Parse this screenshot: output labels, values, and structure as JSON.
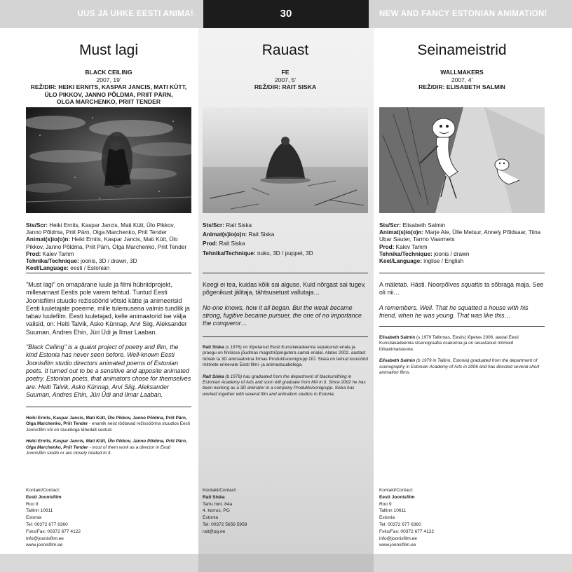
{
  "header": {
    "left_text": "UUS JA UHKE EESTI ANIMA!",
    "page_number": "30",
    "right_text": "NEW AND FANCY ESTONIAN ANIMATION!"
  },
  "films": [
    {
      "title": "Must lagi",
      "en_title": "BLACK CEILING",
      "year": "2007, 19'",
      "director_lines": [
        "REŽ/DIR: HEIKI ERNITS, KASPAR JANCIS, MATI KÜTT,",
        "ÜLO PIKKOV, JANNO PÕLDMA, PRIIT PÄRN,",
        "OLGA MARCHENKO, PRIIT TENDER"
      ],
      "credits": [
        {
          "label": "Sts/Scr:",
          "text": "Heiki Ernits, Kaspar Jancis, Mati Kütt, Ülo Pikkov, Janno Põldma, Priit Pärn, Olga Marchenko, Priit Tender"
        },
        {
          "label": "Animat(s)io(o)n:",
          "text": "Heiki Ernits, Kaspar Jancis, Mati Kütt, Ülo Pikkov, Janno Põldma, Priit Pärn, Olga Marchenko, Priit Tender"
        },
        {
          "label": "Prod:",
          "text": "Kalev Tamm"
        },
        {
          "label": "Tehnika/Technique:",
          "text": "joonis, 3D / drawn, 3D"
        },
        {
          "label": "Keel/Language:",
          "text": "eesti / Estonian"
        }
      ],
      "story_et": "\"Must lagi\" on omapärane luule ja filmi hübriidprojekt, millesarnast Eestis pole varem tehtud. Tuntud Eesti Joonisfilmi stuudio režissöörid võtsid kätte ja animeerisid Eesti luuletajate poeeme, mille tulemusena valmis tundlik ja tabav luulefilm. Eesti luuletajad, kelle animaatorid ise välja valisid, on: Heiti Talvik, Asko Künnap, Arvi Siig, Aleksander Suuman, Andres Ehin, Jüri Üdi ja Ilmar Laaban.",
      "story_en": "\"Black Ceiling\" is a quaint project of poetry and film, the kind Estonia has never seen before. Well-known Eesti Joonisfilm studio directors animated poems of Estonian poets. It turned out to be a sensitive and apposite animated poetry. Estonian poets, that animators chose for themselves are: Heiti Talvik, Asko Künnap, Arvi Siig, Aleksander Suuman, Andres Ehin, Jüri Üdi and Ilmar Laaban.",
      "bio_et_name": "Heiki Ernits, Kaspar Jancis, Mati Kütt, Ülo Pikkov, Janno Põldma, Priit Pärn, Olga Marchenko, Priit Tender",
      "bio_et_text": " - enamik neist töötavad režissöörina stuudios Eesti Joonisfilm või on stuudioga lähedalt seotud.",
      "bio_en_name": "Heiki Ernits, Kaspar Jancis, Mati Kütt, Ülo Pikkov, Janno Põldma, Priit Pärn, Olga Marchenko, Priit Tender",
      "bio_en_text": " - most of them work as a director in Eesti Joonisfilm studio or are closely related to it.",
      "contact_label": "Kontakt/Contact:",
      "contact_name": "Eesti Joonisfilm",
      "contact_lines": [
        "Roo 9",
        "Tallinn 10611",
        "Estonia",
        "Tel: 00372 677 6360",
        "Fsks/Fax: 00372 677 4122",
        "info@joonisfilm.ee",
        "www.joonisfilm.ee"
      ]
    },
    {
      "title": "Rauast",
      "en_title": "FE",
      "year": "2007, 5'",
      "director_lines": [
        "REŽ/DIR: RAIT SISKA"
      ],
      "credits": [
        {
          "label": "Sts/Scr:",
          "text": "Rait Siska"
        },
        {
          "label": "Animat(s)io(o)n:",
          "text": "Rait Siska"
        },
        {
          "label": "Prod:",
          "text": "Rait Siska"
        },
        {
          "label": "Tehnika/Technique:",
          "text": "nuku, 3D / puppet, 3D"
        }
      ],
      "story_et": "Keegi ei tea, kuidas kõik sai alguse. Kuid nõrgast sai tugev, põgenikust jälitaja, tähtsusetust vallutaja…",
      "story_en": "No-one knows, how it all began. But the weak became strong, fugitive became pursuer, the one of no importance the conqueror…",
      "bio_et_name": "Rait Siska",
      "bio_et_text": " (s 1976) on lõpetanud Eesti Kunstiakadeemia sepakunsti eriala ja praegu on finišisse jõudmas magistriõpinguteга samal erialal. Alates 2002. aastast töötab ta 3D animaatorina firmas Produktsioonigrupp OÜ. Siska on teinud koostööd mitmete erinevate Eesti filmi- ja animastuudiotega.",
      "bio_en_name": "Rait Siska",
      "bio_en_text": " (b 1976) has graduated from the department of blacksmithing in Estonian Academy of Arts and soon will graduate from MA in it. Since 2002 he has been working as a 3D animator in a company Produktsioonigrupp. Siska has worked together with several film and animation studios in Estonia.",
      "contact_label": "Kontakt/Contact:",
      "contact_name": "Rait Siska",
      "contact_lines": [
        "Tartu mnt. 84a",
        "4. korrus, PG",
        "Estonia",
        "Tel: 00372 5656 5958",
        "rait@pg.ee"
      ]
    },
    {
      "title": "Seinameistrid",
      "en_title": "WALLMAKERS",
      "year": "2007, 4'",
      "director_lines": [
        "REŽ/DIR: ELISABETH SALMIN"
      ],
      "credits": [
        {
          "label": "Sts/Scr:",
          "text": "Elisabeth Salmin"
        },
        {
          "label": "Animat(s)io(o)n:",
          "text": "Marje Ale, Ülle Metsur, Annely Põldsaar, Tiina Ubar Sauter, Tarmo Vaarmets"
        },
        {
          "label": "Prod:",
          "text": "Kalev Tamm"
        },
        {
          "label": "Tehnika/Technique:",
          "text": "joonis / drawn"
        },
        {
          "label": "Keel/Language:",
          "text": "inglise / English"
        }
      ],
      "story_et_pre": "A mäletab. Hästi. Noorpõlves ",
      "story_et_em": "squattis",
      "story_et_post": " ta sõbraga maja. See oli nii…",
      "story_en": "A remembers. Well. That he squatted a house with his friend, when he was young. That was like this…",
      "bio_et_name": "Elisabeth Salmin",
      "bio_et_text": " (s 1979 Tallinnas, Eestis) lõpetas 2006. aastal Eesti Kunstiakadeemia stsenograafia osakonna ja on lavastanud mitmeid lühianimatsioone.",
      "bio_en_name": "Elisabeth Salmin",
      "bio_en_text": " (b 1979 in Tallinn, Estonia) graduated from the department of scenography in Estonian Academy of Arts in 2006 and has directed several short animation films.",
      "contact_label": "Kontakt/Contact:",
      "contact_name": "Eesti Joonisfilm",
      "contact_lines": [
        "Roo 9",
        "Tallinn 10611",
        "Estonia",
        "Tel: 00372 677 6360",
        "Fsks/Fax: 00372 677 4122",
        "info@joonisfilm.ee",
        "www.joonisfilm.ee"
      ]
    }
  ]
}
